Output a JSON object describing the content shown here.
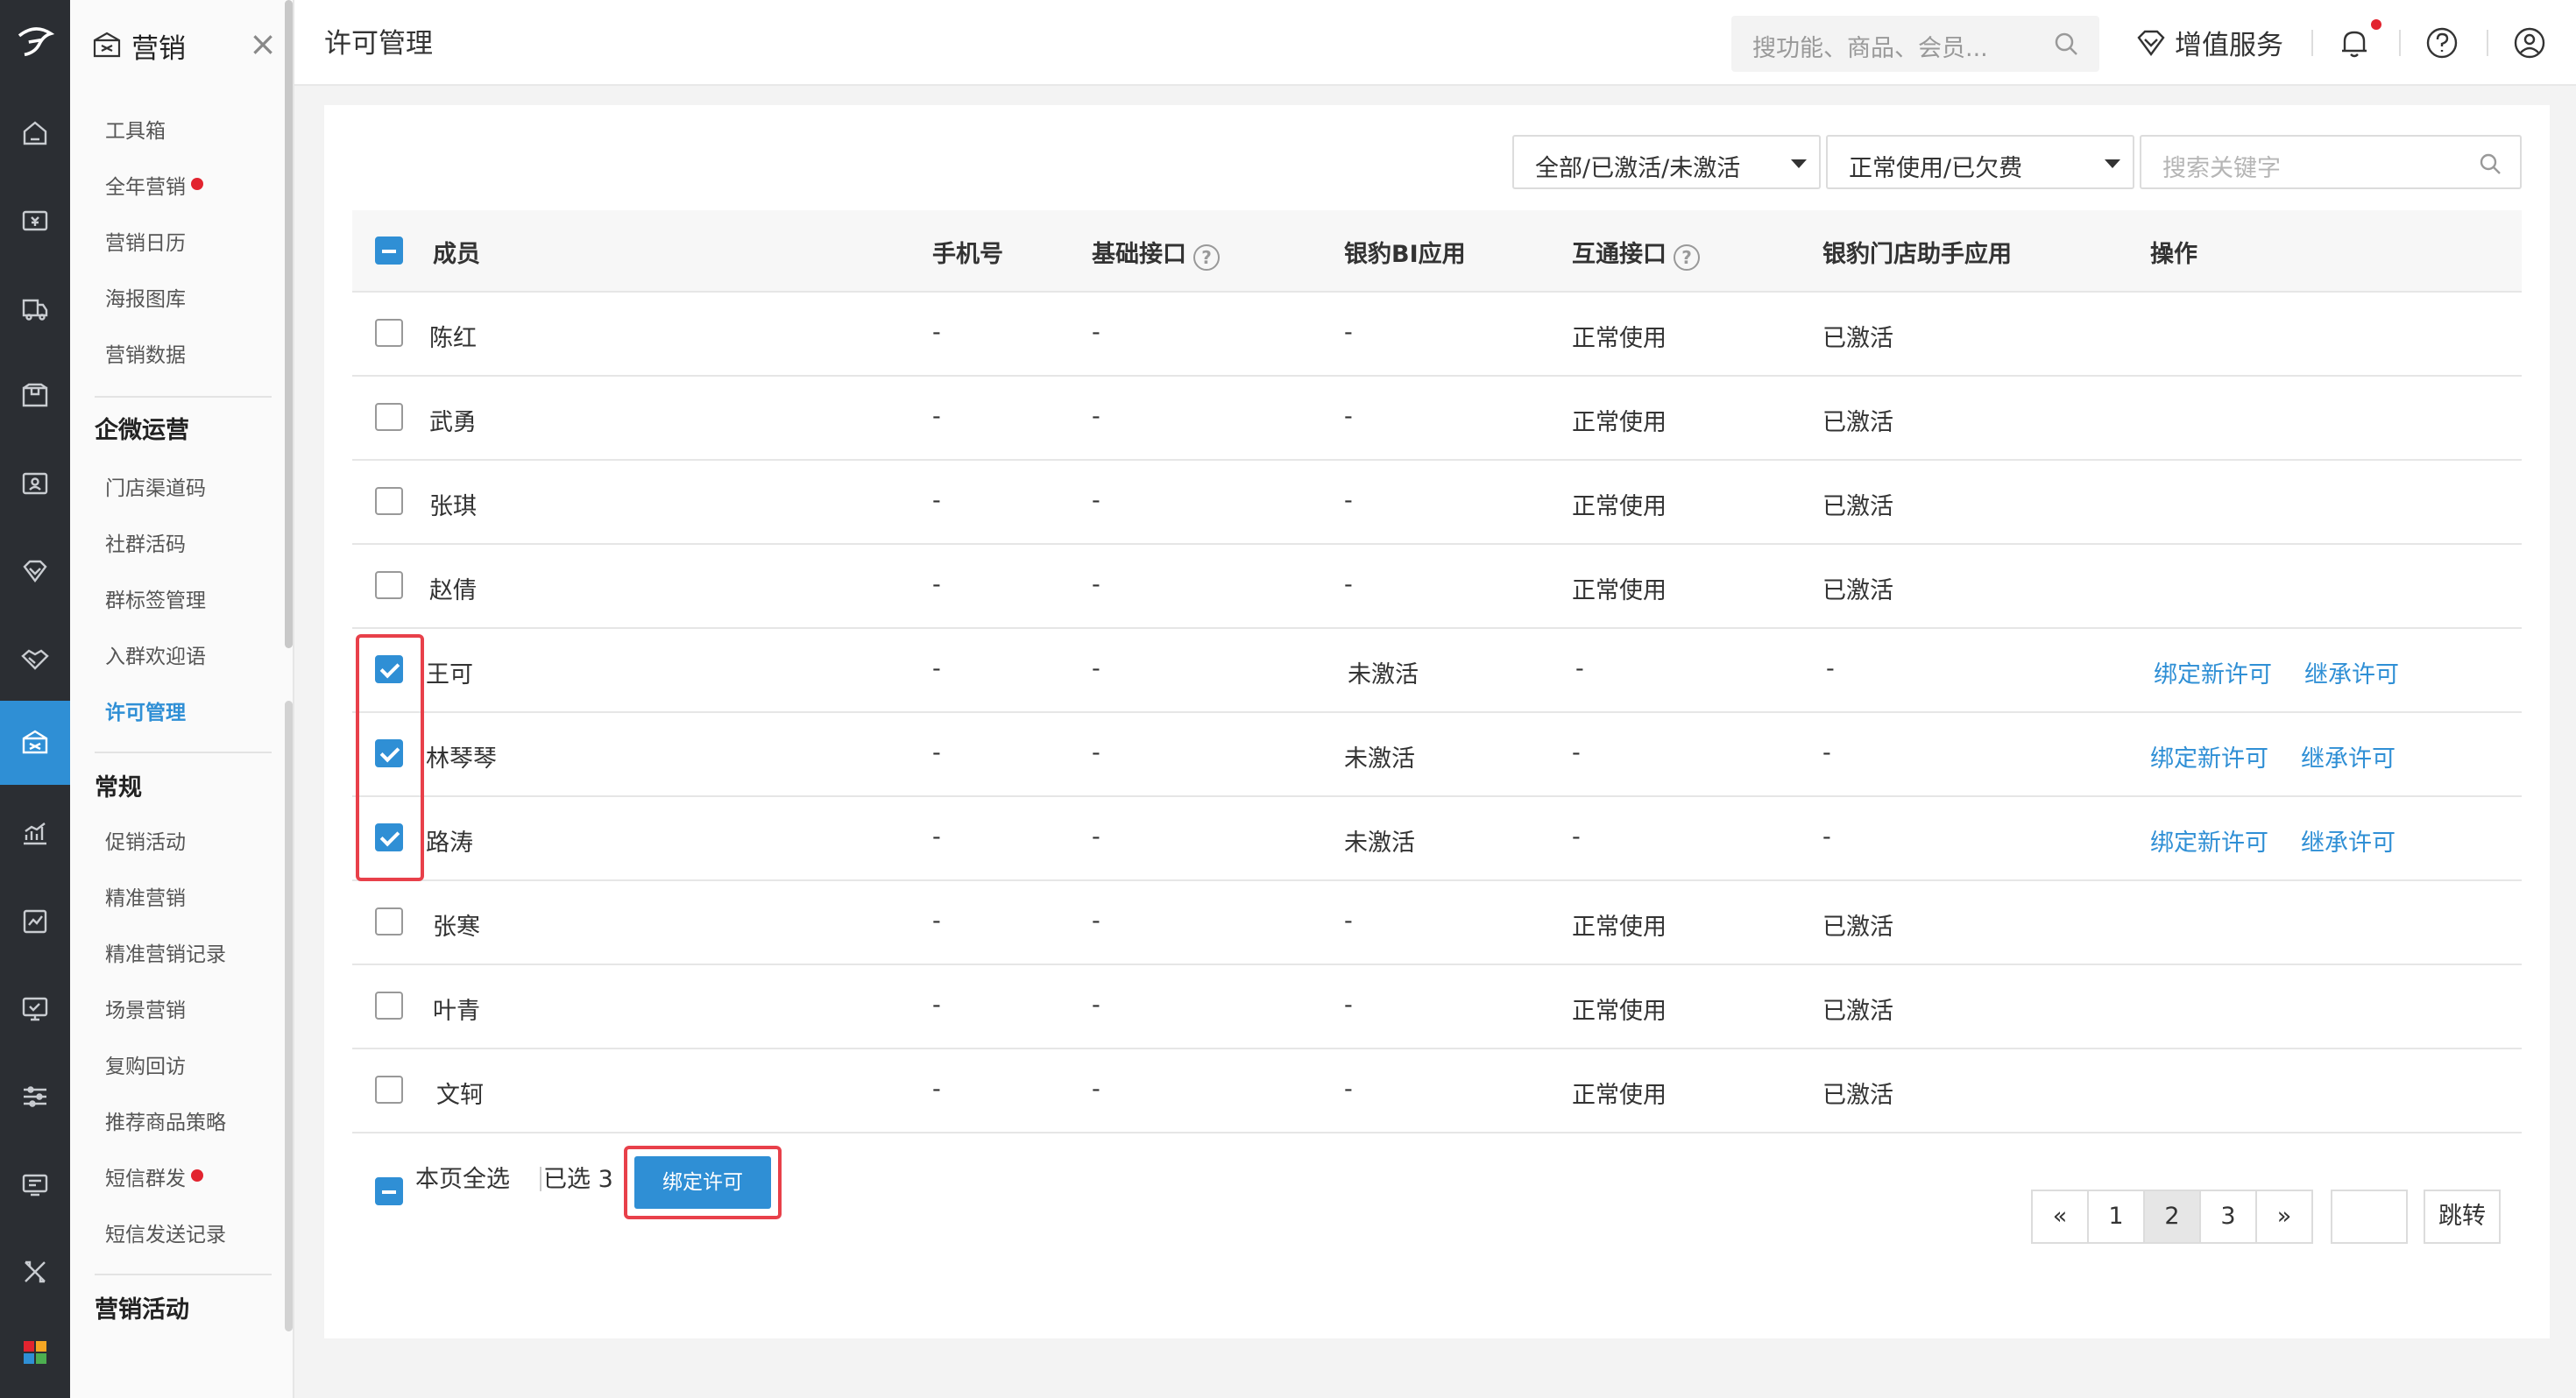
{
  "sidebar": {
    "title": "营销",
    "close_label": "×",
    "items_top": [
      {
        "label": "工具箱",
        "dot": false
      },
      {
        "label": "全年营销",
        "dot": true
      },
      {
        "label": "营销日历",
        "dot": false
      },
      {
        "label": "海报图库",
        "dot": false
      },
      {
        "label": "营销数据",
        "dot": false
      }
    ],
    "group_wechat": "企微运营",
    "items_wechat": [
      {
        "label": "门店渠道码"
      },
      {
        "label": "社群活码"
      },
      {
        "label": "群标签管理"
      },
      {
        "label": "入群欢迎语"
      },
      {
        "label": "许可管理",
        "active": true
      }
    ],
    "group_regular": "常规",
    "items_regular": [
      {
        "label": "促销活动",
        "dot": false
      },
      {
        "label": "精准营销",
        "dot": false
      },
      {
        "label": "精准营销记录",
        "dot": false
      },
      {
        "label": "场景营销",
        "dot": false
      },
      {
        "label": "复购回访",
        "dot": false
      },
      {
        "label": "推荐商品策略",
        "dot": false
      },
      {
        "label": "短信群发",
        "dot": true
      },
      {
        "label": "短信发送记录",
        "dot": false
      }
    ],
    "group_activity": "营销活动"
  },
  "topbar": {
    "page_title": "许可管理",
    "search_placeholder": "搜功能、商品、会员...",
    "value_added": "增值服务"
  },
  "filters": {
    "activation": "全部/已激活/未激活",
    "usage": "正常使用/已欠费",
    "keyword_placeholder": "搜索关键字"
  },
  "table": {
    "headers": {
      "member": "成员",
      "phone": "手机号",
      "basic_api": "基础接口",
      "bi_app": "银豹BI应用",
      "interop_api": "互通接口",
      "store_assistant": "银豹门店助手应用",
      "actions": "操作"
    },
    "rows": [
      {
        "name": "陈红",
        "phone": "-",
        "basic": "-",
        "bi": "-",
        "interop": "正常使用",
        "assistant": "已激活",
        "checked": false,
        "a1": "",
        "a2": ""
      },
      {
        "name": "武勇",
        "phone": "-",
        "basic": "-",
        "bi": "-",
        "interop": "正常使用",
        "assistant": "已激活",
        "checked": false,
        "a1": "",
        "a2": ""
      },
      {
        "name": "张琪",
        "phone": "-",
        "basic": "-",
        "bi": "-",
        "interop": "正常使用",
        "assistant": "已激活",
        "checked": false,
        "a1": "",
        "a2": ""
      },
      {
        "name": "赵倩",
        "phone": "-",
        "basic": "-",
        "bi": "-",
        "interop": "正常使用",
        "assistant": "已激活",
        "checked": false,
        "a1": "",
        "a2": ""
      },
      {
        "name": "王可",
        "phone": "-",
        "basic": "-",
        "bi": "未激活",
        "interop": "-",
        "assistant": "-",
        "checked": true,
        "a1": "绑定新许可",
        "a2": "继承许可"
      },
      {
        "name": "林琴琴",
        "phone": "-",
        "basic": "-",
        "bi": "未激活",
        "interop": "-",
        "assistant": "-",
        "checked": true,
        "a1": "绑定新许可",
        "a2": "继承许可"
      },
      {
        "name": "路涛",
        "phone": "-",
        "basic": "-",
        "bi": "未激活",
        "interop": "-",
        "assistant": "-",
        "checked": true,
        "a1": "绑定新许可",
        "a2": "继承许可"
      },
      {
        "name": "张寒",
        "phone": "-",
        "basic": "-",
        "bi": "-",
        "interop": "正常使用",
        "assistant": "已激活",
        "checked": false,
        "a1": "",
        "a2": ""
      },
      {
        "name": "叶青",
        "phone": "-",
        "basic": "-",
        "bi": "-",
        "interop": "正常使用",
        "assistant": "已激活",
        "checked": false,
        "a1": "",
        "a2": ""
      },
      {
        "name": "文轲",
        "phone": "-",
        "basic": "-",
        "bi": "-",
        "interop": "正常使用",
        "assistant": "已激活",
        "checked": false,
        "a1": "",
        "a2": ""
      }
    ]
  },
  "footer": {
    "select_page": "本页全选",
    "selected": "已选 3",
    "bind_button": "绑定许可"
  },
  "pagination": {
    "prev": "«",
    "pages": [
      "1",
      "2",
      "3"
    ],
    "current": "2",
    "next": "»",
    "jump_label": "跳转"
  }
}
